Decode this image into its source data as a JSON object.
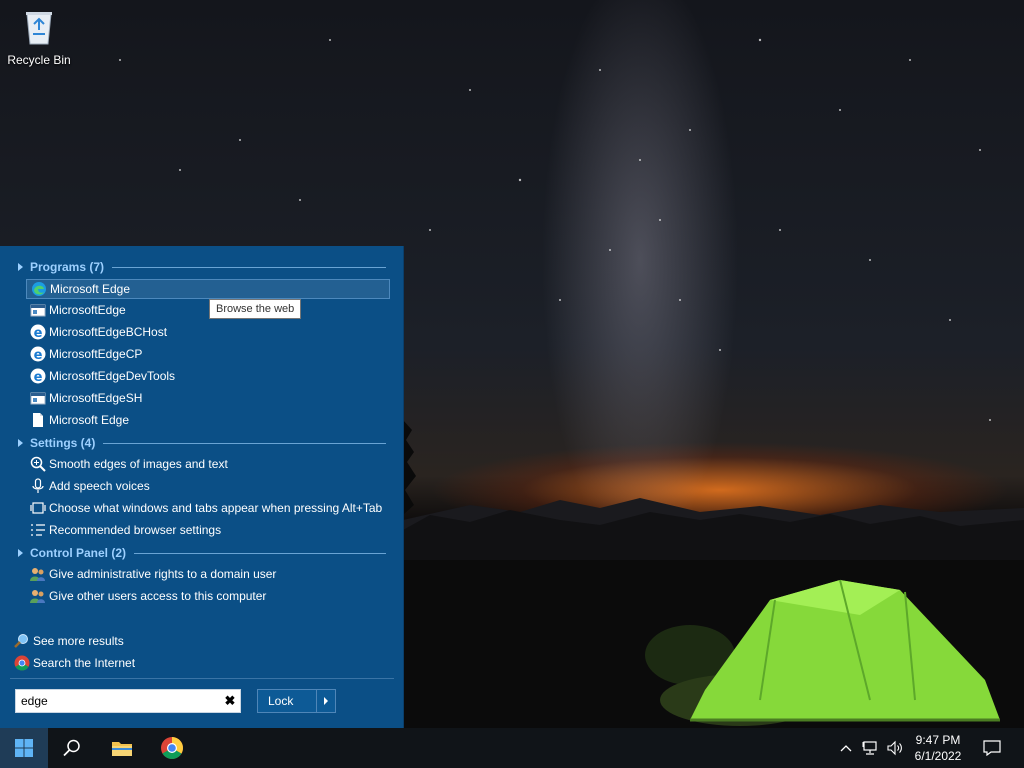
{
  "desktop": {
    "recycle_bin_label": "Recycle Bin"
  },
  "start_menu": {
    "groups": {
      "programs": {
        "title": "Programs (7)",
        "items": [
          {
            "label": "Microsoft Edge",
            "icon": "edge-icon"
          },
          {
            "label": "MicrosoftEdge",
            "icon": "app-window-icon"
          },
          {
            "label": "MicrosoftEdgeBCHost",
            "icon": "edge-legacy-icon"
          },
          {
            "label": "MicrosoftEdgeCP",
            "icon": "edge-legacy-icon"
          },
          {
            "label": "MicrosoftEdgeDevTools",
            "icon": "edge-legacy-icon"
          },
          {
            "label": "MicrosoftEdgeSH",
            "icon": "app-window-icon"
          },
          {
            "label": "Microsoft Edge",
            "icon": "document-icon"
          }
        ]
      },
      "settings": {
        "title": "Settings (4)",
        "items": [
          {
            "label": "Smooth edges of images and text",
            "icon": "magnifier-icon"
          },
          {
            "label": "Add speech voices",
            "icon": "microphone-icon"
          },
          {
            "label": "Choose what windows and tabs appear when pressing Alt+Tab",
            "icon": "multitasking-icon"
          },
          {
            "label": "Recommended browser settings",
            "icon": "list-settings-icon"
          }
        ]
      },
      "control_panel": {
        "title": "Control Panel (2)",
        "items": [
          {
            "label": "Give administrative rights to a domain user",
            "icon": "users-icon"
          },
          {
            "label": "Give other users access to this computer",
            "icon": "users-icon"
          }
        ]
      }
    },
    "see_more_results": "See more results",
    "search_internet": "Search the Internet",
    "search_value": "edge",
    "clear_symbol": "✖",
    "lock_label": "Lock"
  },
  "tooltip": "Browse the web",
  "taskbar": {
    "time": "9:47 PM",
    "date": "6/1/2022"
  },
  "colors": {
    "menu_bg": "#0b4f86",
    "group_header": "#9dd0ff",
    "taskbar_bg": "#101418",
    "tent": "#8fe34a"
  }
}
